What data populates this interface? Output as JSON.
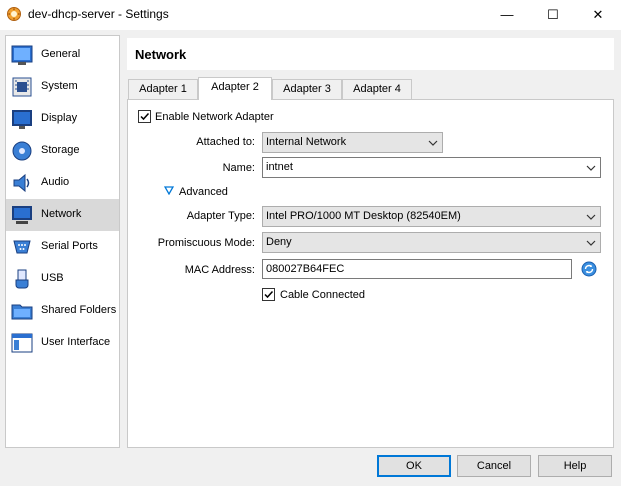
{
  "window": {
    "title": "dev-dhcp-server - Settings",
    "minimize": "—",
    "maximize": "☐",
    "close": "✕"
  },
  "sidebar": {
    "items": [
      {
        "label": "General",
        "icon": "general-icon"
      },
      {
        "label": "System",
        "icon": "system-icon"
      },
      {
        "label": "Display",
        "icon": "display-icon"
      },
      {
        "label": "Storage",
        "icon": "storage-icon"
      },
      {
        "label": "Audio",
        "icon": "audio-icon"
      },
      {
        "label": "Network",
        "icon": "network-icon",
        "active": true
      },
      {
        "label": "Serial Ports",
        "icon": "serial-ports-icon"
      },
      {
        "label": "USB",
        "icon": "usb-icon"
      },
      {
        "label": "Shared Folders",
        "icon": "shared-folders-icon"
      },
      {
        "label": "User Interface",
        "icon": "user-interface-icon"
      }
    ]
  },
  "header": {
    "title": "Network"
  },
  "tabs": [
    {
      "label": "Adapter 1"
    },
    {
      "label": "Adapter 2",
      "active": true
    },
    {
      "label": "Adapter 3"
    },
    {
      "label": "Adapter 4"
    }
  ],
  "adapter": {
    "enable_label": "Enable Network Adapter",
    "enable_checked": true,
    "attached_to_label": "Attached to:",
    "attached_to_value": "Internal Network",
    "name_label": "Name:",
    "name_value": "intnet",
    "advanced_label": "Advanced",
    "adapter_type_label": "Adapter Type:",
    "adapter_type_value": "Intel PRO/1000 MT Desktop (82540EM)",
    "promiscuous_label": "Promiscuous Mode:",
    "promiscuous_value": "Deny",
    "mac_label": "MAC Address:",
    "mac_value": "080027B64FEC",
    "cable_label": "Cable Connected",
    "cable_checked": true
  },
  "buttons": {
    "ok": "OK",
    "cancel": "Cancel",
    "help": "Help"
  },
  "colors": {
    "accent": "#0078d7",
    "selected_bg": "#d9d9d9"
  }
}
